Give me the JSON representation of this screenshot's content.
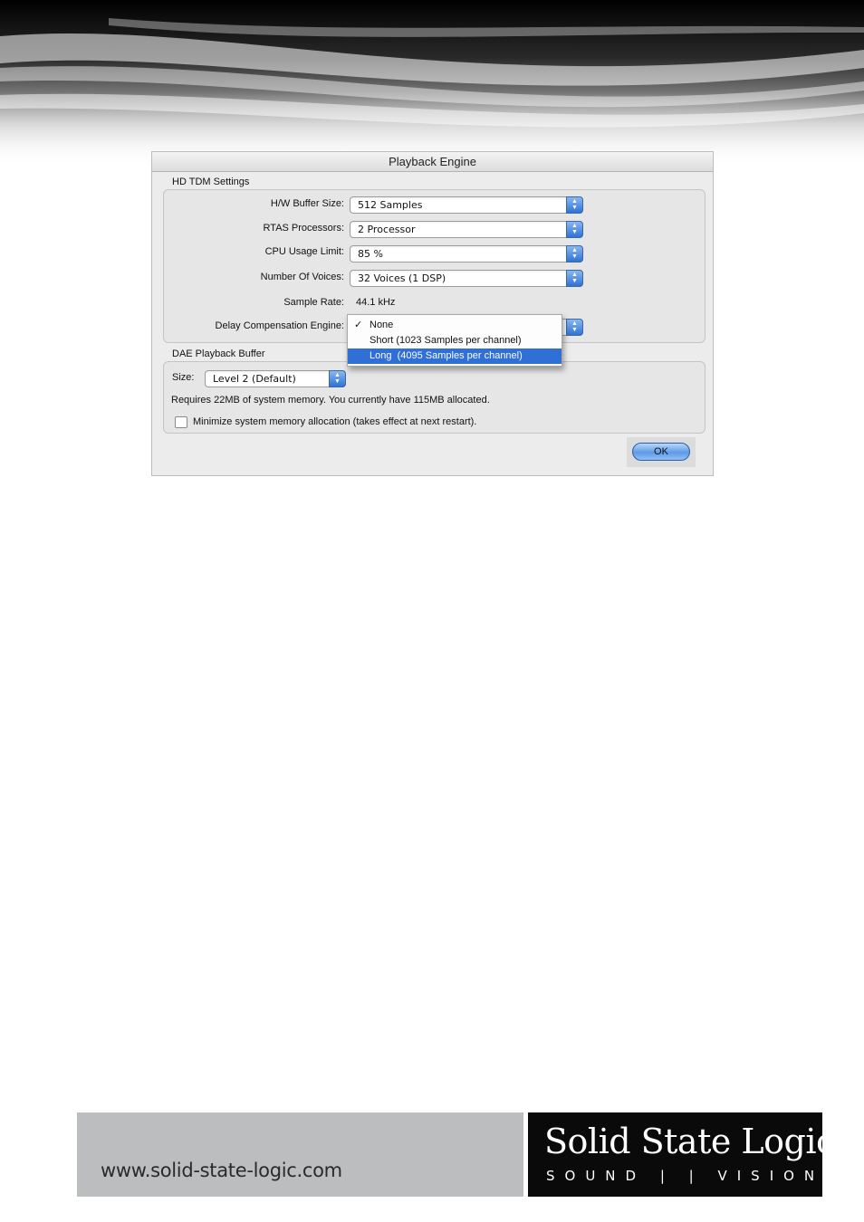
{
  "dialog": {
    "title": "Playback Engine",
    "hd_tdm": {
      "group_label": "HD TDM Settings",
      "hw_buffer": {
        "label": "H/W Buffer Size:",
        "value": "512 Samples"
      },
      "rtas": {
        "label": "RTAS Processors:",
        "value": "2 Processor"
      },
      "cpu": {
        "label": "CPU Usage Limit:",
        "value": "85 %"
      },
      "voices": {
        "label": "Number Of Voices:",
        "value": "32 Voices (1 DSP)"
      },
      "sample_rate": {
        "label": "Sample Rate:",
        "value": "44.1 kHz"
      },
      "delay_comp": {
        "label": "Delay Compensation Engine:",
        "menu": [
          {
            "label": "None",
            "check": "✓"
          },
          {
            "label": "Short (1023 Samples per channel)"
          },
          {
            "label": "Long  (4095 Samples per channel)"
          }
        ]
      }
    },
    "dae": {
      "group_label": "DAE Playback Buffer",
      "size_label": "Size:",
      "size_value": "Level 2 (Default)",
      "memory_note": "Requires 22MB of system memory. You currently have 115MB allocated.",
      "minimize_label": "Minimize system memory allocation (takes effect at next restart)."
    },
    "ok_label": "OK"
  },
  "footer": {
    "url": "www.solid-state-logic.com",
    "logo_name": "Solid State Logic",
    "logo_tagline": "SOUND | | VISION"
  },
  "colors": {
    "accent_blue": "#2f6fd6",
    "footer_gray": "#bcbdbf",
    "logo_black": "#0a0a0a"
  },
  "icons": {
    "popup_arrows": "up-down-arrows-icon",
    "check": "checkmark-icon"
  }
}
